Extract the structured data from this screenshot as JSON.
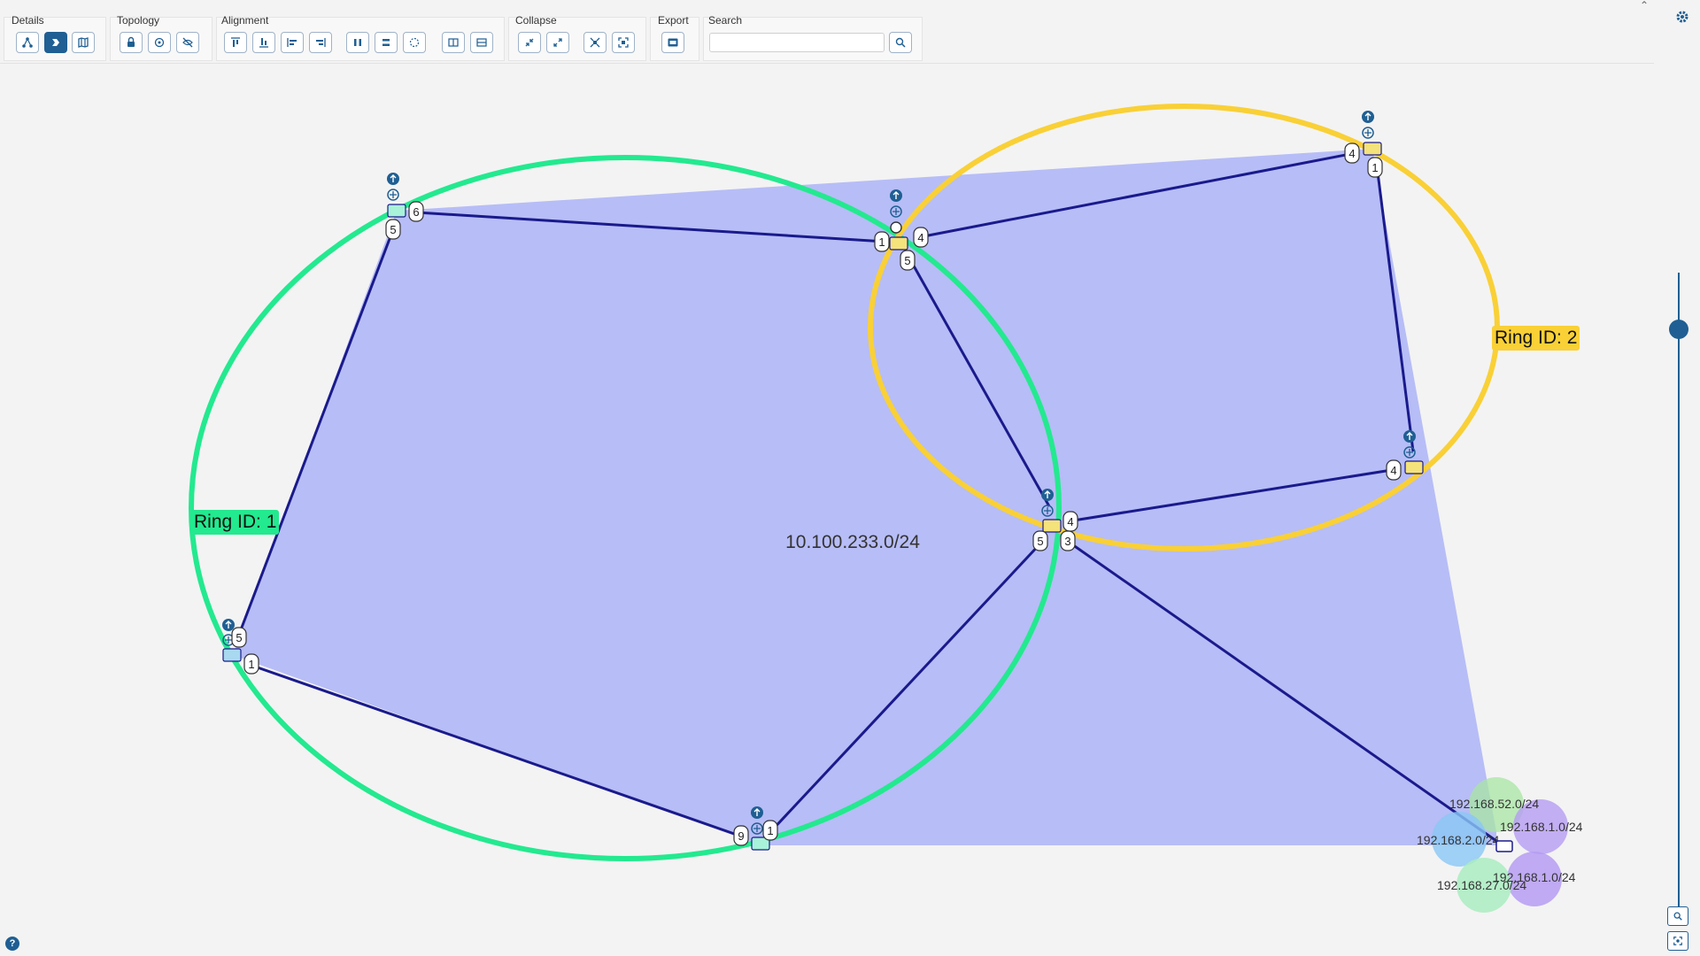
{
  "toolbar": {
    "groups": {
      "details": "Details",
      "topology": "Topology",
      "alignment": "Alignment",
      "collapse": "Collapse",
      "export": "Export",
      "search": "Search"
    },
    "search_placeholder": "",
    "search_value": ""
  },
  "diagram": {
    "subnet_label": "10.100.233.0/24",
    "ring1_label": "Ring ID: 1",
    "ring2_label": "Ring ID: 2",
    "cluster_labels": {
      "c52": "192.168.52.0/24",
      "c1a": "192.168.1.0/24",
      "c2": "192.168.2.0/24",
      "c1b": "192.168.1.0/24",
      "c27": "192.168.27.0/24"
    },
    "ports": {
      "n1_a": "6",
      "n1_b": "5",
      "n2_a": "1",
      "n2_b": "4",
      "n2_c": "5",
      "n3_a": "4",
      "n3_b": "1",
      "n4_a": "4",
      "n5_a": "4",
      "n5_b": "5",
      "n5_c": "3",
      "n6_a": "5",
      "n6_b": "1",
      "n7_a": "9",
      "n7_b": "1"
    }
  },
  "colors": {
    "subnet_fill": "#b3b9f5",
    "link": "#1a1a8c",
    "ring1": "#23e98f",
    "ring2": "#f9d036",
    "accent": "#1f5f93"
  },
  "zoom": {
    "level": 0.91
  }
}
